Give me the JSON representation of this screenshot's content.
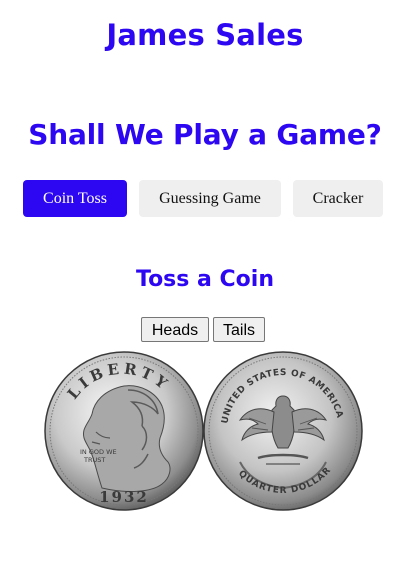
{
  "header": {
    "site_title": "James Sales"
  },
  "main": {
    "heading": "Shall We Play a Game?",
    "tabs": [
      {
        "label": "Coin Toss",
        "active": true
      },
      {
        "label": "Guessing Game",
        "active": false
      },
      {
        "label": "Cracker",
        "active": false
      }
    ]
  },
  "coin_toss": {
    "heading": "Toss a Coin",
    "heads_label": "Heads",
    "tails_label": "Tails",
    "image": {
      "obverse_text": "LIBERTY",
      "motto": "IN GOD WE TRUST",
      "year": "1932",
      "reverse_top": "UNITED STATES OF AMERICA",
      "reverse_bottom": "QUARTER DOLLAR"
    }
  },
  "colors": {
    "accent": "#2d06f2",
    "button_bg": "#efefef"
  }
}
